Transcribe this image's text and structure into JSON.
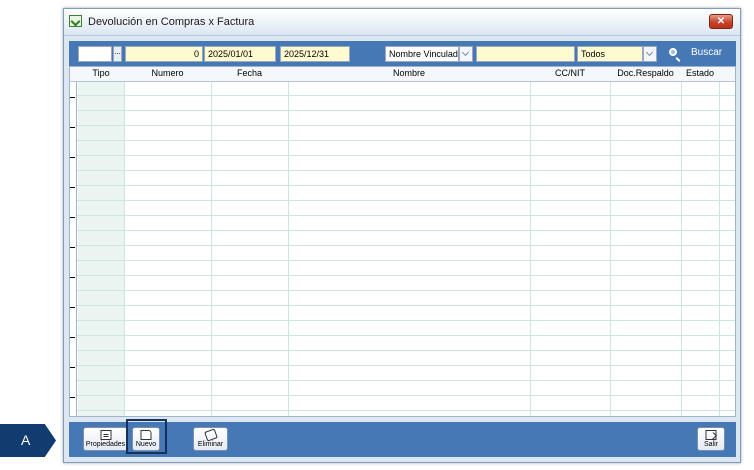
{
  "window": {
    "title": "Devolución en Compras x Factura",
    "close_glyph": "✕"
  },
  "filters": {
    "field1": "",
    "ellipsis": "...",
    "number": "0",
    "date_from": "2025/01/01",
    "date_to": "2025/12/31",
    "search_by": "Nombre Vinculado",
    "search_text": "",
    "status": "Todos",
    "search_label": "Buscar"
  },
  "grid": {
    "columns": [
      "Tipo",
      "Numero",
      "Fecha",
      "Nombre",
      "CC/NIT",
      "Doc.Respaldo",
      "Estado"
    ],
    "rows": []
  },
  "buttons": {
    "properties": "Propiedades",
    "new": "Nuevo",
    "delete": "Eliminar",
    "exit": "Salir"
  },
  "annotation": {
    "label": "A"
  },
  "icons": {
    "app": "green-check-app-icon",
    "search": "search-icon",
    "properties": "properties-icon",
    "new": "new-document-icon",
    "delete": "eraser-icon",
    "exit": "exit-door-icon"
  }
}
